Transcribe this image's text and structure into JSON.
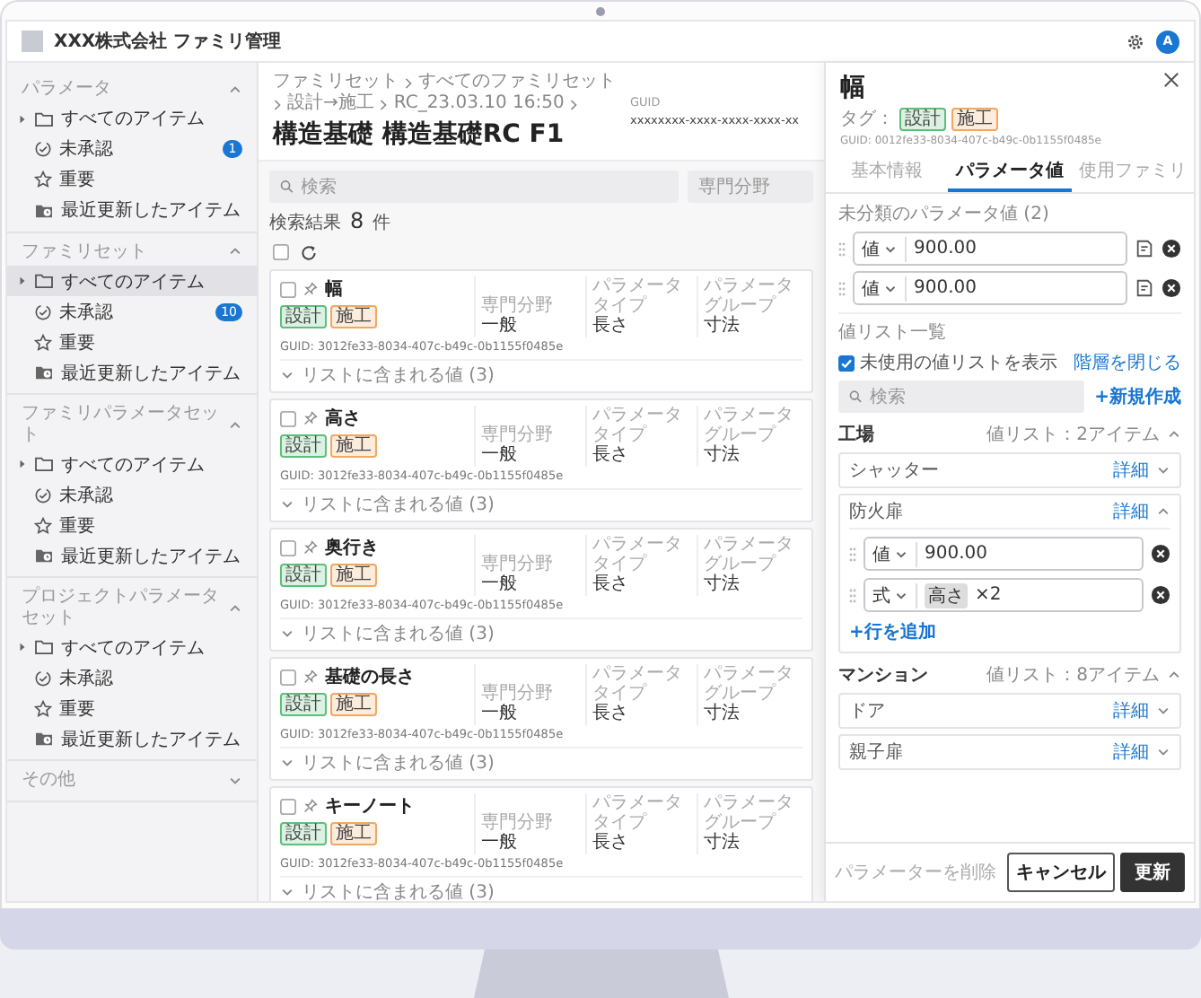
{
  "app_bar": {
    "title": "XXX株式会社 ファミリ管理",
    "avatar": "A"
  },
  "sidebar": {
    "sections": [
      {
        "title": "パラメータ",
        "expanded": true,
        "items": [
          {
            "kind": "all",
            "label": "すべてのアイテム",
            "selected": false
          },
          {
            "kind": "unapproved",
            "label": "未承認",
            "selected": false,
            "badge": "1"
          },
          {
            "kind": "important",
            "label": "重要",
            "selected": false
          },
          {
            "kind": "recent",
            "label": "最近更新したアイテム",
            "selected": false
          }
        ]
      },
      {
        "title": "ファミリセット",
        "expanded": true,
        "items": [
          {
            "kind": "all",
            "label": "すべてのアイテム",
            "selected": true
          },
          {
            "kind": "unapproved",
            "label": "未承認",
            "selected": false,
            "badge": "10"
          },
          {
            "kind": "important",
            "label": "重要",
            "selected": false
          },
          {
            "kind": "recent",
            "label": "最近更新したアイテム",
            "selected": false
          }
        ]
      },
      {
        "title": "ファミリパラメータセット",
        "expanded": true,
        "items": [
          {
            "kind": "all",
            "label": "すべてのアイテム",
            "selected": false
          },
          {
            "kind": "unapproved",
            "label": "未承認",
            "selected": false
          },
          {
            "kind": "important",
            "label": "重要",
            "selected": false
          },
          {
            "kind": "recent",
            "label": "最近更新したアイテム",
            "selected": false
          }
        ]
      },
      {
        "title": "プロジェクトパラメータセット",
        "expanded": true,
        "items": [
          {
            "kind": "all",
            "label": "すべてのアイテム",
            "selected": false
          },
          {
            "kind": "unapproved",
            "label": "未承認",
            "selected": false
          },
          {
            "kind": "important",
            "label": "重要",
            "selected": false
          },
          {
            "kind": "recent",
            "label": "最近更新したアイテム",
            "selected": false
          }
        ]
      },
      {
        "title": "その他",
        "expanded": false
      }
    ]
  },
  "header": {
    "breadcrumb": [
      "ファミリセット",
      "すべてのファミリセット",
      "設計→施工",
      "RC_23.03.10 16:50"
    ],
    "title": "構造基礎 構造基礎RC F1",
    "guid_label": "GUID",
    "guid_value": "xxxxxxxx-xxxx-xxxx-xxxx-xx"
  },
  "toolbar": {
    "search_placeholder": "検索",
    "filter": "専門分野"
  },
  "results": {
    "label": "検索結果",
    "count": "8",
    "unit": "件"
  },
  "select_all": {
    "checked": false
  },
  "cards": [
    {
      "name": "幅",
      "checked": false,
      "tags": [
        {
          "label": "設計",
          "color": "#5cbf7a"
        },
        {
          "label": "施工",
          "color": "#f0a860"
        }
      ],
      "guid": "GUID: 3012fe33-8034-407c-b49c-0b1155f0485e",
      "fields": [
        {
          "label": "専門分野",
          "value": "一般"
        },
        {
          "label": "パラメータタイプ",
          "value": "長さ"
        },
        {
          "label": "パラメータグループ",
          "value": "寸法"
        }
      ],
      "footer": "リストに含まれる値 (3)",
      "expanded": false
    },
    {
      "name": "高さ",
      "checked": false,
      "tags": [
        {
          "label": "設計",
          "color": "#5cbf7a"
        },
        {
          "label": "施工",
          "color": "#f0a860"
        }
      ],
      "guid": "GUID: 3012fe33-8034-407c-b49c-0b1155f0485e",
      "fields": [
        {
          "label": "専門分野",
          "value": "一般"
        },
        {
          "label": "パラメータタイプ",
          "value": "長さ"
        },
        {
          "label": "パラメータグループ",
          "value": "寸法"
        }
      ],
      "footer": "リストに含まれる値 (3)",
      "expanded": false
    },
    {
      "name": "奥行き",
      "checked": false,
      "tags": [
        {
          "label": "設計",
          "color": "#5cbf7a"
        },
        {
          "label": "施工",
          "color": "#f0a860"
        }
      ],
      "guid": "GUID: 3012fe33-8034-407c-b49c-0b1155f0485e",
      "fields": [
        {
          "label": "専門分野",
          "value": "一般"
        },
        {
          "label": "パラメータタイプ",
          "value": "長さ"
        },
        {
          "label": "パラメータグループ",
          "value": "寸法"
        }
      ],
      "footer": "リストに含まれる値 (3)",
      "expanded": false
    },
    {
      "name": "基礎の長さ",
      "checked": false,
      "tags": [
        {
          "label": "設計",
          "color": "#5cbf7a"
        },
        {
          "label": "施工",
          "color": "#f0a860"
        }
      ],
      "guid": "GUID: 3012fe33-8034-407c-b49c-0b1155f0485e",
      "fields": [
        {
          "label": "専門分野",
          "value": "一般"
        },
        {
          "label": "パラメータタイプ",
          "value": "長さ"
        },
        {
          "label": "パラメータグループ",
          "value": "寸法"
        }
      ],
      "footer": "リストに含まれる値 (3)",
      "expanded": false
    },
    {
      "name": "キーノート",
      "checked": false,
      "tags": [
        {
          "label": "設計",
          "color": "#5cbf7a"
        },
        {
          "label": "施工",
          "color": "#f0a860"
        }
      ],
      "guid": "GUID: 3012fe33-8034-407c-b49c-0b1155f0485e",
      "fields": [
        {
          "label": "専門分野",
          "value": "一般"
        },
        {
          "label": "パラメータタイプ",
          "value": "長さ"
        },
        {
          "label": "パラメータグループ",
          "value": "寸法"
        }
      ],
      "footer": "リストに含まれる値 (3)",
      "expanded": false
    }
  ],
  "panel": {
    "title": "幅",
    "tags_label": "タグ：",
    "tags": [
      {
        "label": "設計",
        "color": "#5cbf7a"
      },
      {
        "label": "施工",
        "color": "#f0a860"
      }
    ],
    "guid": "GUID: 0012fe33-8034-407c-b49c-0b1155f0485e",
    "tabs": [
      {
        "label": "基本情報",
        "selected": false
      },
      {
        "label": "パラメータ値",
        "selected": true
      },
      {
        "label": "使用ファミリ",
        "selected": false
      }
    ],
    "uncategorized": {
      "label": "未分類のパラメータ値 (2)",
      "rows": [
        {
          "kind": "value",
          "type": "値",
          "value": "900.00"
        },
        {
          "kind": "value",
          "type": "値",
          "value": "900.00"
        }
      ]
    },
    "value_lists": {
      "label": "値リスト一覧",
      "show_unused": {
        "label": "未使用の値リストを表示",
        "checked": true
      },
      "collapse_link": "階層を閉じる",
      "search_placeholder": "検索",
      "create": "+新規作成",
      "groups": [
        {
          "name": "工場",
          "count": "値リスト：2アイテム",
          "expanded": true,
          "items": [
            {
              "name": "シャッター",
              "detail": "詳細",
              "expanded": false
            },
            {
              "name": "防火扉",
              "detail": "詳細",
              "expanded": true,
              "rows": [
                {
                  "kind": "value",
                  "type": "値",
                  "value": "900.00"
                },
                {
                  "kind": "formula",
                  "type": "式",
                  "token": "高さ",
                  "value": "×2"
                }
              ],
              "add_row": "+行を追加"
            }
          ]
        },
        {
          "name": "マンション",
          "count": "値リスト：8アイテム",
          "expanded": true,
          "items": [
            {
              "name": "ドア",
              "detail": "詳細",
              "expanded": false
            },
            {
              "name": "親子扉",
              "detail": "詳細",
              "expanded": false
            }
          ]
        }
      ]
    },
    "footer": {
      "delete": "パラメーターを削除",
      "cancel": "キャンセル",
      "submit": "更新"
    }
  }
}
